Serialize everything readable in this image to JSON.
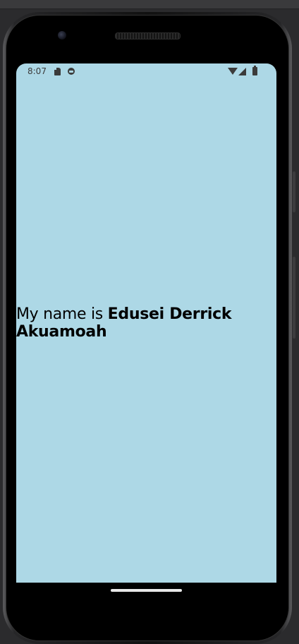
{
  "status_bar": {
    "time": "8:07",
    "icons": [
      "sd-card-icon",
      "android-debug-icon",
      "wifi-icon",
      "cell-signal-icon",
      "battery-icon"
    ]
  },
  "app": {
    "background_color": "#add8e6",
    "message_prefix": "My name is ",
    "message_name": "Edusei Derrick Akuamoah"
  }
}
